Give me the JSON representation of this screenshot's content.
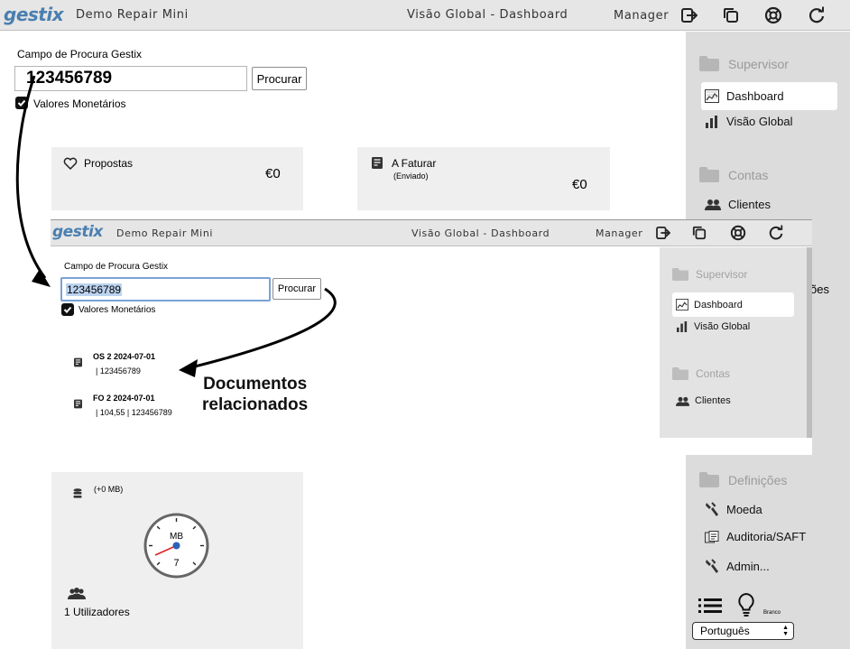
{
  "app": {
    "logo": "gestix",
    "company": "Demo Repair Mini",
    "view_title": "Visão Global - Dashboard",
    "user": "Manager"
  },
  "search": {
    "label": "Campo de Procura Gestix",
    "value": "123456789",
    "button": "Procurar",
    "monetary_label": "Valores Monetários",
    "monetary_checked": true
  },
  "cards": {
    "propostas": {
      "label": "Propostas",
      "value": "€0"
    },
    "a_faturar": {
      "label": "A Faturar",
      "sub": "(Enviado)",
      "value": "€0"
    },
    "storage": {
      "label": "(+0 MB)",
      "gauge_unit": "MB",
      "gauge_value": "7"
    },
    "users": {
      "label": "1 Utilizadores"
    }
  },
  "sidebar": {
    "groups": [
      {
        "label": "Supervisor",
        "items": [
          "Dashboard",
          "Visão Global"
        ]
      },
      {
        "label": "Contas",
        "items": [
          "Clientes"
        ]
      },
      {
        "label": "Definições",
        "items": [
          "Moeda",
          "Auditoria/SAFT",
          "Admin..."
        ]
      }
    ],
    "partial_text": "ões",
    "theme_label": "Branco",
    "language": "Português"
  },
  "related_docs": [
    {
      "title": "OS 2 2024-07-01",
      "detail": "| 123456789"
    },
    {
      "title": "FO 2 2024-07-01",
      "detail": "| 104,55 | 123456789"
    }
  ],
  "annotation": {
    "line1": "Documentos",
    "line2": "relacionados"
  }
}
